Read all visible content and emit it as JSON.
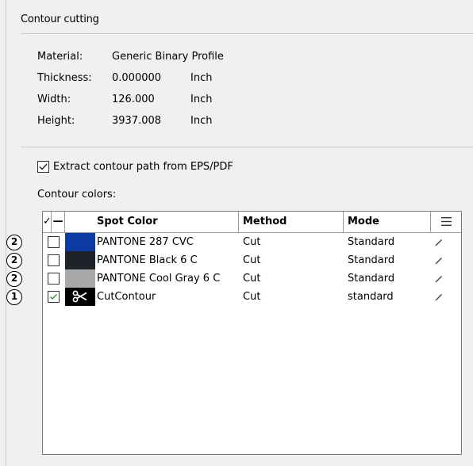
{
  "section": {
    "title": "Contour cutting"
  },
  "info": [
    {
      "label": "Material:",
      "value": "Generic Binary Profile",
      "unit": ""
    },
    {
      "label": "Thickness:",
      "value": "0.000000",
      "unit": "Inch"
    },
    {
      "label": "Width:",
      "value": "126.000",
      "unit": "Inch"
    },
    {
      "label": "Height:",
      "value": "3937.008",
      "unit": "Inch"
    }
  ],
  "extract": {
    "label": "Extract contour path from EPS/PDF",
    "checked": true
  },
  "contour_colors_label": "Contour colors:",
  "table": {
    "header": {
      "check_symbol": "✓",
      "swatch_symbol": "—",
      "spot_color": "Spot Color",
      "method": "Method",
      "mode": "Mode",
      "menu_icon": "hamburger-icon"
    },
    "rows": [
      {
        "badge": "2",
        "checked": false,
        "swatch_color": "#0b3aa3",
        "swatch_icon": "",
        "spot_color": "PANTONE 287 CVC",
        "method": "Cut",
        "mode": "Standard"
      },
      {
        "badge": "2",
        "checked": false,
        "swatch_color": "#1e2329",
        "swatch_icon": "",
        "spot_color": "PANTONE Black 6 C",
        "method": "Cut",
        "mode": "Standard"
      },
      {
        "badge": "2",
        "checked": false,
        "swatch_color": "#a7a8aa",
        "swatch_icon": "",
        "spot_color": "PANTONE Cool Gray 6 C",
        "method": "Cut",
        "mode": "Standard"
      },
      {
        "badge": "1",
        "checked": true,
        "swatch_color": "#000000",
        "swatch_icon": "scissors-icon",
        "spot_color": "CutContour",
        "method": "Cut",
        "mode": "standard"
      }
    ]
  }
}
